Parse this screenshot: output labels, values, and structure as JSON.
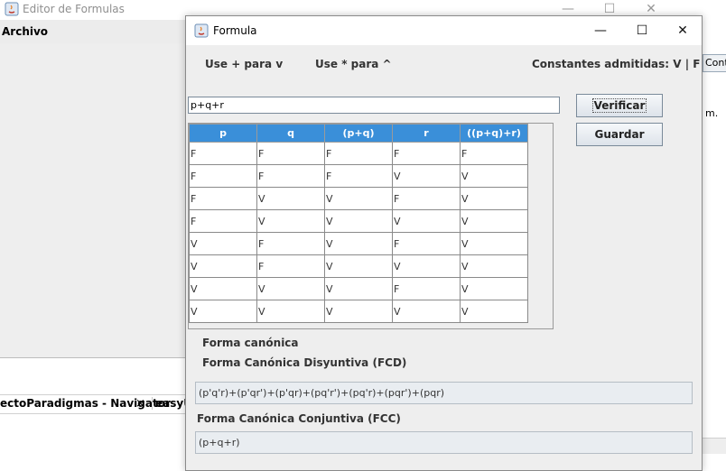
{
  "background_window": {
    "title": "Editor de Formulas",
    "menu": [
      "Archivo"
    ]
  },
  "bottom_tabs": {
    "navigator": "ectoParadigmas - Navigator",
    "close": "×",
    "other": "easyU"
  },
  "right_peek": {
    "button_text": "Contr",
    "text": "m."
  },
  "window": {
    "title": "Formula",
    "controls": {
      "minimize": "—",
      "maximize": "☐",
      "close": "✕"
    }
  },
  "hints": {
    "or": "Use + para v",
    "and": "Use  * para ^",
    "constants": "Constantes admitidas: V | F"
  },
  "formula": {
    "value": "p+q+r"
  },
  "buttons": {
    "verify": "Verificar",
    "save": "Guardar"
  },
  "table": {
    "headers": [
      "p",
      "q",
      "(p+q)",
      "r",
      "((p+q)+r)"
    ],
    "rows": [
      [
        "F",
        "F",
        "F",
        "F",
        "F"
      ],
      [
        "F",
        "F",
        "F",
        "V",
        "V"
      ],
      [
        "F",
        "V",
        "V",
        "F",
        "V"
      ],
      [
        "F",
        "V",
        "V",
        "V",
        "V"
      ],
      [
        "V",
        "F",
        "V",
        "F",
        "V"
      ],
      [
        "V",
        "F",
        "V",
        "V",
        "V"
      ],
      [
        "V",
        "V",
        "V",
        "F",
        "V"
      ],
      [
        "V",
        "V",
        "V",
        "V",
        "V"
      ]
    ]
  },
  "canonical": {
    "label": "Forma canónica",
    "fcd_label": "Forma Canónica Disyuntiva (FCD)",
    "fcd_value": "(p'q'r)+(p'qr')+(p'qr)+(pq'r')+(pq'r)+(pqr')+(pqr)",
    "fcc_label": "Forma Canónica Conjuntiva (FCC)",
    "fcc_value": "(p+q+r)"
  },
  "colors": {
    "header_bg": "#3a8fd9",
    "window_bg": "#eeeeee"
  }
}
